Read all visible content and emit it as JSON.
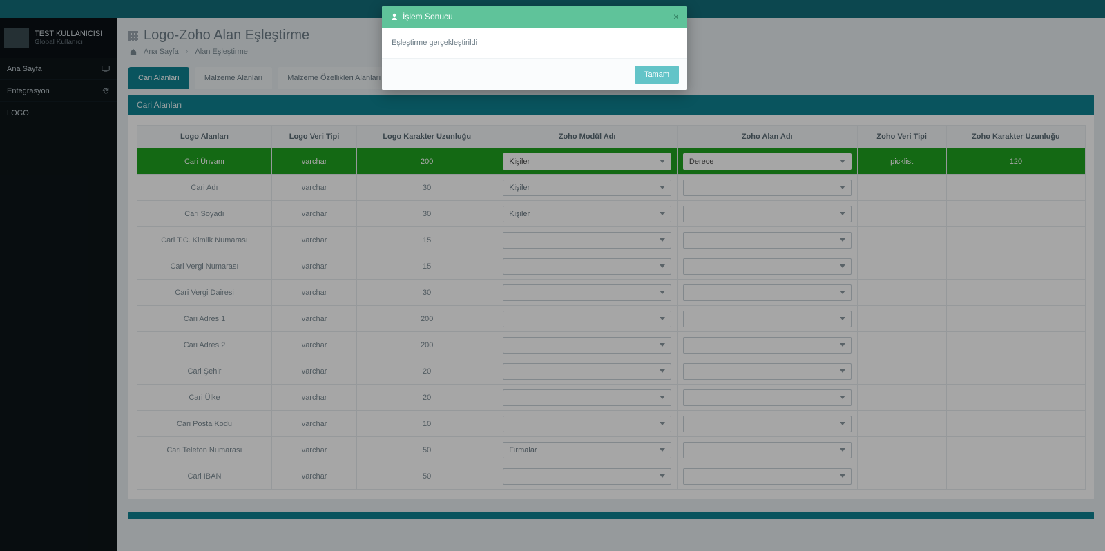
{
  "user": {
    "name": "TEST KULLANICISI",
    "sub": "Global Kullanıcı"
  },
  "sidebar": {
    "items": [
      {
        "label": "Ana Sayfa",
        "icon": "monitor"
      },
      {
        "label": "Entegrasyon",
        "icon": "refresh"
      },
      {
        "label": "LOGO",
        "icon": ""
      }
    ]
  },
  "page": {
    "title": "Logo-Zoho Alan Eşleştirme",
    "breadcrumb": [
      "Ana Sayfa",
      "Alan Eşleştirme"
    ]
  },
  "tabs": [
    {
      "label": "Cari Alanları",
      "active": true
    },
    {
      "label": "Malzeme Alanları",
      "active": false
    },
    {
      "label": "Malzeme Özellikleri Alanları",
      "active": false
    }
  ],
  "panel": {
    "title": "Cari Alanları"
  },
  "table": {
    "headers": [
      "Logo Alanları",
      "Logo Veri Tipi",
      "Logo Karakter Uzunluğu",
      "Zoho Modül Adı",
      "Zoho Alan Adı",
      "Zoho Veri Tipi",
      "Zoho Karakter Uzunluğu"
    ],
    "rows": [
      {
        "logoField": "Cari Ünvanı",
        "logoType": "varchar",
        "logoLen": "200",
        "zohoModule": "Kişiler",
        "zohoField": "Derece",
        "zohoType": "picklist",
        "zohoLen": "120",
        "hl": true
      },
      {
        "logoField": "Cari Adı",
        "logoType": "varchar",
        "logoLen": "30",
        "zohoModule": "Kişiler",
        "zohoField": "",
        "zohoType": "",
        "zohoLen": ""
      },
      {
        "logoField": "Cari Soyadı",
        "logoType": "varchar",
        "logoLen": "30",
        "zohoModule": "Kişiler",
        "zohoField": "",
        "zohoType": "",
        "zohoLen": ""
      },
      {
        "logoField": "Cari T.C. Kimlik Numarası",
        "logoType": "varchar",
        "logoLen": "15",
        "zohoModule": "",
        "zohoField": "",
        "zohoType": "",
        "zohoLen": ""
      },
      {
        "logoField": "Cari Vergi Numarası",
        "logoType": "varchar",
        "logoLen": "15",
        "zohoModule": "",
        "zohoField": "",
        "zohoType": "",
        "zohoLen": ""
      },
      {
        "logoField": "Cari Vergi Dairesi",
        "logoType": "varchar",
        "logoLen": "30",
        "zohoModule": "",
        "zohoField": "",
        "zohoType": "",
        "zohoLen": ""
      },
      {
        "logoField": "Cari Adres 1",
        "logoType": "varchar",
        "logoLen": "200",
        "zohoModule": "",
        "zohoField": "",
        "zohoType": "",
        "zohoLen": ""
      },
      {
        "logoField": "Cari Adres 2",
        "logoType": "varchar",
        "logoLen": "200",
        "zohoModule": "",
        "zohoField": "",
        "zohoType": "",
        "zohoLen": ""
      },
      {
        "logoField": "Cari Şehir",
        "logoType": "varchar",
        "logoLen": "20",
        "zohoModule": "",
        "zohoField": "",
        "zohoType": "",
        "zohoLen": ""
      },
      {
        "logoField": "Cari Ülke",
        "logoType": "varchar",
        "logoLen": "20",
        "zohoModule": "",
        "zohoField": "",
        "zohoType": "",
        "zohoLen": ""
      },
      {
        "logoField": "Cari Posta Kodu",
        "logoType": "varchar",
        "logoLen": "10",
        "zohoModule": "",
        "zohoField": "",
        "zohoType": "",
        "zohoLen": ""
      },
      {
        "logoField": "Cari Telefon Numarası",
        "logoType": "varchar",
        "logoLen": "50",
        "zohoModule": "Firmalar",
        "zohoField": "",
        "zohoType": "",
        "zohoLen": ""
      },
      {
        "logoField": "Cari IBAN",
        "logoType": "varchar",
        "logoLen": "50",
        "zohoModule": "",
        "zohoField": "",
        "zohoType": "",
        "zohoLen": ""
      }
    ]
  },
  "modal": {
    "title": "İşlem Sonucu",
    "body": "Eşleştirme gerçekleştirildi",
    "ok": "Tamam"
  }
}
